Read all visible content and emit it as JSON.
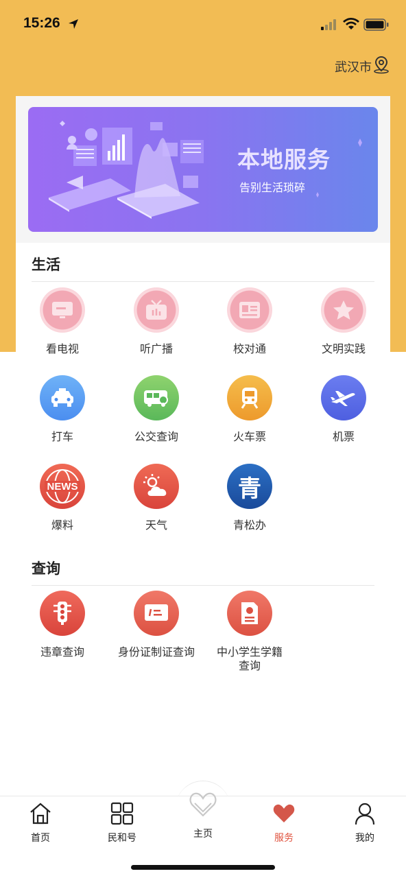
{
  "status": {
    "time": "15:26"
  },
  "header": {
    "city": "武汉市"
  },
  "banner": {
    "title": "本地服务",
    "subtitle": "告别生活琐碎"
  },
  "sections": {
    "life": {
      "title": "生活",
      "items": [
        {
          "label": "看电视",
          "icon": "tv-screen-icon"
        },
        {
          "label": "听广播",
          "icon": "radio-icon"
        },
        {
          "label": "校对通",
          "icon": "id-card-icon"
        },
        {
          "label": "文明实践",
          "icon": "star-icon"
        },
        {
          "label": "打车",
          "icon": "taxi-icon"
        },
        {
          "label": "公交查询",
          "icon": "bus-icon"
        },
        {
          "label": "火车票",
          "icon": "train-icon"
        },
        {
          "label": "机票",
          "icon": "airplane-icon"
        },
        {
          "label": "爆料",
          "icon": "news-globe-icon",
          "icon_text": "NEWS"
        },
        {
          "label": "天气",
          "icon": "weather-icon"
        },
        {
          "label": "青松办",
          "icon": "qing-logo-icon",
          "icon_text": "青"
        }
      ]
    },
    "query": {
      "title": "查询",
      "items": [
        {
          "label": "违章查询",
          "icon": "traffic-light-icon"
        },
        {
          "label": "身份证制证查询",
          "icon": "id-card-query-icon"
        },
        {
          "label": "中小学生学籍查询",
          "label_line1": "中小学生学籍",
          "label_line2": "查询",
          "icon": "student-record-icon"
        }
      ]
    }
  },
  "tabbar": {
    "items": [
      {
        "label": "首页",
        "icon": "home-icon"
      },
      {
        "label": "民和号",
        "icon": "grid-icon"
      },
      {
        "label": "主页",
        "icon": "heart-outline-icon"
      },
      {
        "label": "服务",
        "icon": "heart-filled-icon",
        "active": true
      },
      {
        "label": "我的",
        "icon": "user-icon"
      }
    ],
    "active_color": "#e0533f"
  },
  "colors": {
    "header_bg": "#f2bc54",
    "banner_start": "#9b6cf3",
    "banner_end": "#6a86ec"
  }
}
